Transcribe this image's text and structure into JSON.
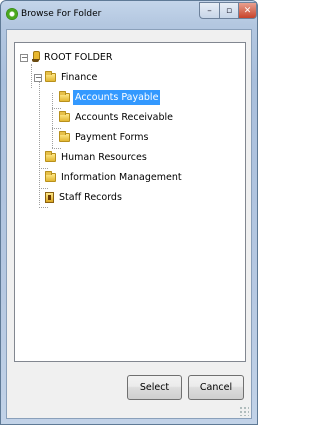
{
  "window": {
    "title": "Browse For Folder",
    "close_glyph": "✕",
    "max_glyph": "▫",
    "min_glyph": "–"
  },
  "tree": {
    "root": {
      "label": "ROOT FOLDER",
      "expanded": true,
      "icon": "root-drive-icon"
    },
    "items": [
      {
        "label": "Finance",
        "level": 1,
        "expanded": true,
        "icon": "folder-icon"
      },
      {
        "label": "Accounts Payable",
        "level": 2,
        "selected": true,
        "icon": "folder-icon"
      },
      {
        "label": "Accounts Receivable",
        "level": 2,
        "icon": "folder-icon"
      },
      {
        "label": "Payment Forms",
        "level": 2,
        "icon": "folder-icon"
      },
      {
        "label": "Human Resources",
        "level": 1,
        "icon": "folder-icon"
      },
      {
        "label": "Information Management",
        "level": 1,
        "icon": "folder-icon"
      },
      {
        "label": "Staff Records",
        "level": 1,
        "icon": "staff-folder-icon"
      }
    ],
    "expander_glyph": "−"
  },
  "buttons": {
    "select": "Select",
    "cancel": "Cancel"
  },
  "colors": {
    "selection": "#3399ff",
    "titlebar": "#b3c7e0",
    "dialog_bg": "#f0f0f0"
  }
}
